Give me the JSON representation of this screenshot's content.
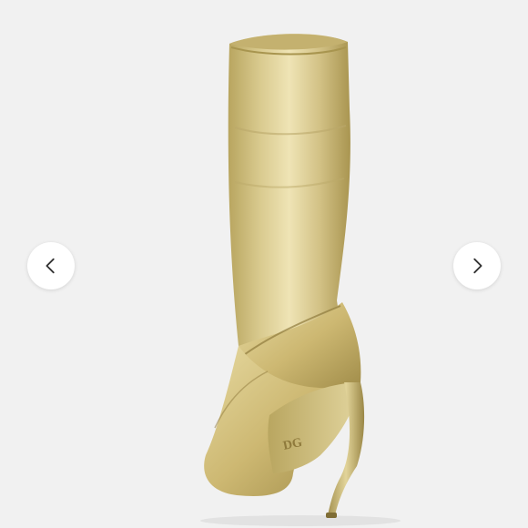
{
  "gallery": {
    "prev_icon": "chevron-left-icon",
    "next_icon": "chevron-right-icon",
    "logo_text": "DG"
  },
  "colors": {
    "background": "#f1f1f1",
    "gold_light": "#e9dda6",
    "gold_mid": "#c9b46a",
    "gold_dark": "#8f7a3c",
    "button": "#ffffff",
    "chevron": "#333333"
  }
}
